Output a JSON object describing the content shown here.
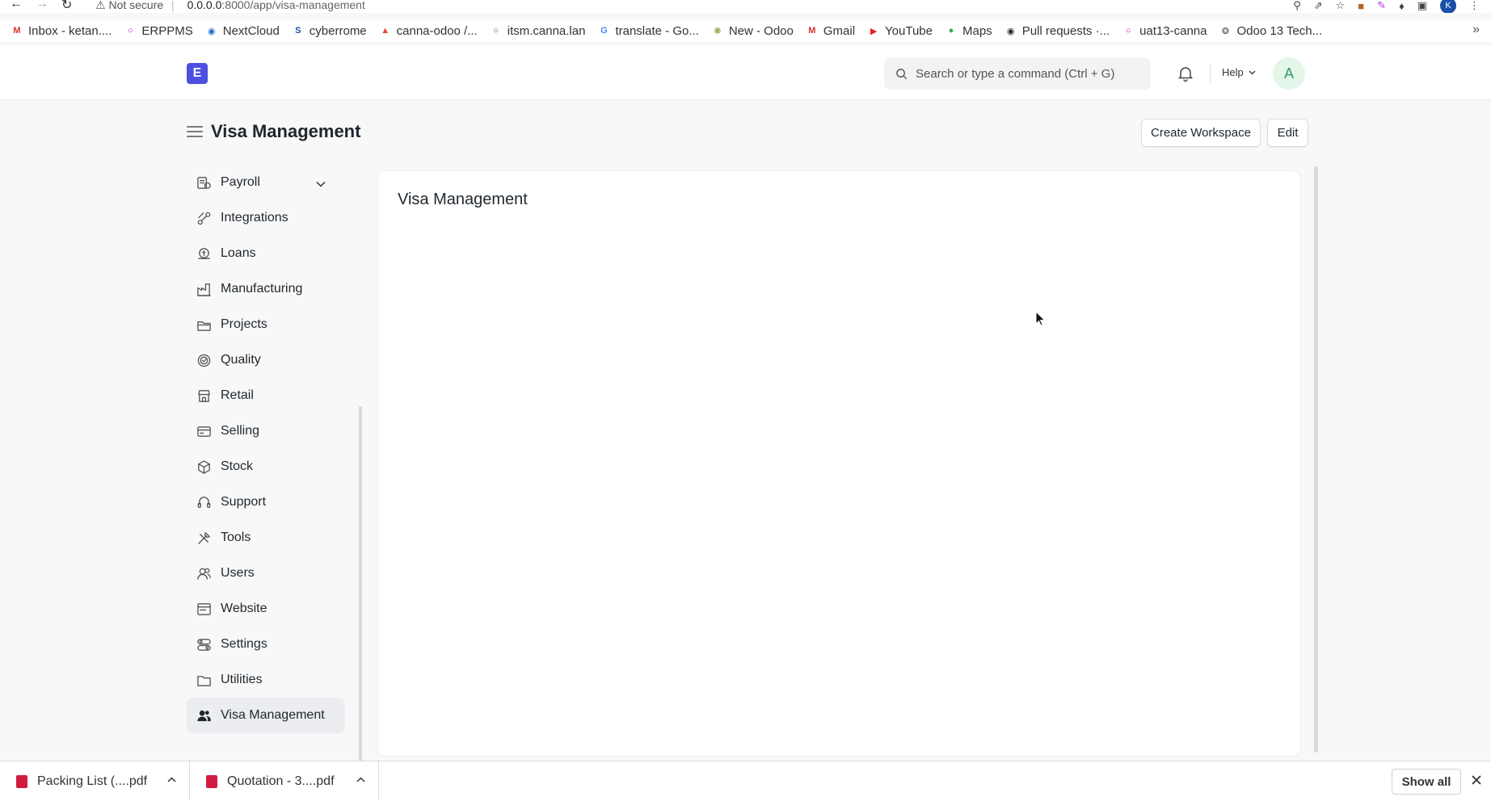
{
  "browser": {
    "security_label": "Not secure",
    "url_host": "0.0.0.0",
    "url_path": ":8000/app/visa-management",
    "profile_initial": "K"
  },
  "bookmarks": [
    {
      "label": "Inbox - ketan....",
      "icon": "gmail-icon",
      "color": "#d93025"
    },
    {
      "label": "ERPPMS",
      "icon": "ring-icon",
      "color": "#a020a0"
    },
    {
      "label": "NextCloud",
      "icon": "nextcloud-icon",
      "color": "#1e68c9"
    },
    {
      "label": "cyberrome",
      "icon": "s-icon",
      "color": "#1a4fa8"
    },
    {
      "label": "canna-odoo /...",
      "icon": "gitlab-icon",
      "color": "#e24329"
    },
    {
      "label": "itsm.canna.lan",
      "icon": "ring-icon",
      "color": "#a020a0"
    },
    {
      "label": "translate - Go...",
      "icon": "google-icon",
      "color": "#4285f4"
    },
    {
      "label": "New - Odoo",
      "icon": "turtle-icon",
      "color": "#7a9a2a"
    },
    {
      "label": "Gmail",
      "icon": "gmail-icon",
      "color": "#d93025"
    },
    {
      "label": "YouTube",
      "icon": "youtube-icon",
      "color": "#e62117"
    },
    {
      "label": "Maps",
      "icon": "maps-icon",
      "color": "#34a853"
    },
    {
      "label": "Pull requests ·...",
      "icon": "github-icon",
      "color": "#222222"
    },
    {
      "label": "uat13-canna",
      "icon": "ring-icon",
      "color": "#a020a0"
    },
    {
      "label": "Odoo 13 Tech...",
      "icon": "feather-icon",
      "color": "#555555"
    }
  ],
  "navbar": {
    "logo_letter": "E",
    "search_placeholder": "Search or type a command (Ctrl + G)",
    "help_label": "Help",
    "user_initial": "A"
  },
  "page": {
    "title": "Visa Management",
    "create_workspace_label": "Create Workspace",
    "edit_label": "Edit"
  },
  "sidebar": {
    "items": [
      {
        "label": "Payroll",
        "icon": "payroll-icon",
        "expandable": true
      },
      {
        "label": "Integrations",
        "icon": "integrations-icon"
      },
      {
        "label": "Loans",
        "icon": "loans-icon"
      },
      {
        "label": "Manufacturing",
        "icon": "manufacturing-icon"
      },
      {
        "label": "Projects",
        "icon": "projects-icon"
      },
      {
        "label": "Quality",
        "icon": "quality-icon"
      },
      {
        "label": "Retail",
        "icon": "retail-icon"
      },
      {
        "label": "Selling",
        "icon": "selling-icon"
      },
      {
        "label": "Stock",
        "icon": "stock-icon"
      },
      {
        "label": "Support",
        "icon": "support-icon"
      },
      {
        "label": "Tools",
        "icon": "tools-icon"
      },
      {
        "label": "Users",
        "icon": "users-icon"
      },
      {
        "label": "Website",
        "icon": "website-icon"
      },
      {
        "label": "Settings",
        "icon": "settings-icon"
      },
      {
        "label": "Utilities",
        "icon": "utilities-icon"
      },
      {
        "label": "Visa Management",
        "icon": "visa-users-icon",
        "active": true
      }
    ]
  },
  "main": {
    "card_title": "Visa Management"
  },
  "downloads": {
    "items": [
      {
        "label": "Packing List (....pdf"
      },
      {
        "label": "Quotation - 3....pdf"
      }
    ],
    "show_all_label": "Show all"
  }
}
